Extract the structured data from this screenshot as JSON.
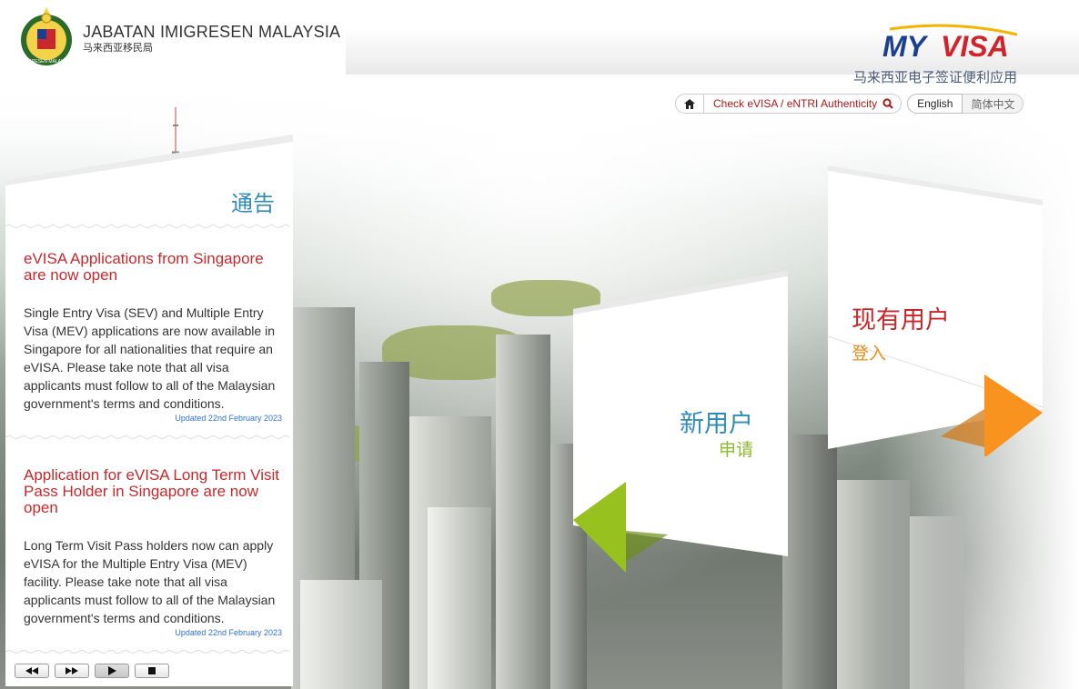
{
  "header": {
    "org_name": "JABATAN IMIGRESEN MALAYSIA",
    "org_sub": "马来西亚移民局",
    "logo_text": "MYVISA",
    "app_subtitle": "马来西亚电子签证便利应用",
    "crest_text": "IMIGRESEN MALAYSIA"
  },
  "nav": {
    "home_icon": "home-icon",
    "check_label": "Check eVISA / eNTRI Authenticity",
    "search_icon": "search-icon",
    "lang_en": "English",
    "lang_zh": "简体中文"
  },
  "announcements": {
    "title": "通告",
    "items": [
      {
        "title": "eVISA Applications from Singapore are now open",
        "body": "Single Entry Visa (SEV) and Multiple Entry Visa (MEV) applications are now available in Singapore for all nationalities that require an eVISA. Please take note that all visa applicants must follow to all of the Malaysian government's terms and conditions.",
        "date": "Updated 22nd February 2023"
      },
      {
        "title": "Application for eVISA Long Term Visit Pass Holder in Singapore are now open",
        "body": "Long Term Visit Pass holders now can apply eVISA for the Multiple Entry Visa (MEV) facility. Please take note that all visa applicants must follow to all of the Malaysian government's terms and conditions.",
        "date": "Updated 22nd February 2023"
      }
    ],
    "pager": [
      "prev",
      "next",
      "play",
      "stop"
    ]
  },
  "new_user": {
    "title": "新用户",
    "sub": "申请"
  },
  "existing_user": {
    "title": "现有用户",
    "sub": "登入"
  },
  "colors": {
    "accent_blue": "#2f8bb7",
    "accent_red": "#c8282c",
    "accent_green": "#8dbb2a",
    "accent_orange": "#ef8c1a"
  }
}
